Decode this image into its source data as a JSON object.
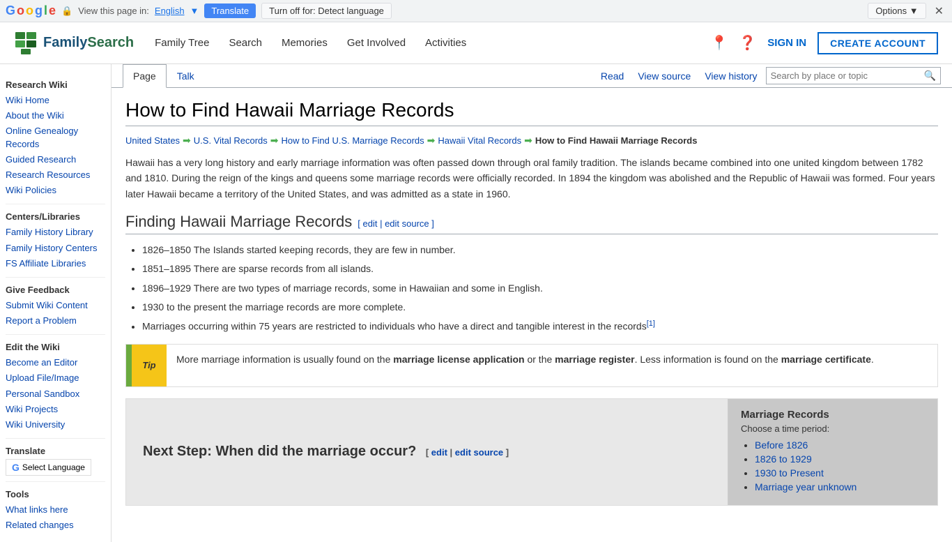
{
  "translateBar": {
    "googleLogo": "Google",
    "lockText": "🔒",
    "viewPageText": "View this page in:",
    "languageLink": "English",
    "languageDropdown": "▼",
    "translateBtn": "Translate",
    "turnOffBtn": "Turn off for: Detect language",
    "optionsBtn": "Options ▼",
    "closeBtn": "✕"
  },
  "nav": {
    "logoText": "FamilySearch",
    "links": [
      "Family Tree",
      "Search",
      "Memories",
      "Get Involved",
      "Activities"
    ],
    "signIn": "SIGN IN",
    "createAccount": "CREATE ACCOUNT"
  },
  "sidebar": {
    "researchWiki": "Research Wiki",
    "links1": [
      {
        "label": "Wiki Home",
        "href": "#"
      },
      {
        "label": "About the Wiki",
        "href": "#"
      },
      {
        "label": "Online Genealogy Records",
        "href": "#"
      },
      {
        "label": "Guided Research",
        "href": "#"
      },
      {
        "label": "Research Resources",
        "href": "#"
      },
      {
        "label": "Wiki Policies",
        "href": "#"
      }
    ],
    "centersLibraries": "Centers/Libraries",
    "links2": [
      {
        "label": "Family History Library",
        "href": "#"
      },
      {
        "label": "Family History Centers",
        "href": "#"
      },
      {
        "label": "FS Affiliate Libraries",
        "href": "#"
      }
    ],
    "giveFeedback": "Give Feedback",
    "links3": [
      {
        "label": "Submit Wiki Content",
        "href": "#"
      },
      {
        "label": "Report a Problem",
        "href": "#"
      }
    ],
    "editWiki": "Edit the Wiki",
    "links4": [
      {
        "label": "Become an Editor",
        "href": "#"
      },
      {
        "label": "Upload File/Image",
        "href": "#"
      },
      {
        "label": "Personal Sandbox",
        "href": "#"
      },
      {
        "label": "Wiki Projects",
        "href": "#"
      },
      {
        "label": "Wiki University",
        "href": "#"
      }
    ],
    "translate": "Translate",
    "selectLanguage": "Select Language",
    "tools": "Tools",
    "links5": [
      {
        "label": "What links here",
        "href": "#"
      },
      {
        "label": "Related changes",
        "href": "#"
      }
    ]
  },
  "tabs": {
    "page": "Page",
    "talk": "Talk",
    "read": "Read",
    "viewSource": "View source",
    "viewHistory": "View history",
    "searchPlaceholder": "Search by place or topic"
  },
  "article": {
    "title": "How to Find Hawaii Marriage Records",
    "breadcrumbs": [
      {
        "label": "United States",
        "href": "#"
      },
      {
        "label": "U.S. Vital Records",
        "href": "#"
      },
      {
        "label": "How to Find U.S. Marriage Records",
        "href": "#"
      },
      {
        "label": "Hawaii Vital Records",
        "href": "#"
      },
      {
        "label": "How to Find Hawaii Marriage Records",
        "current": true
      }
    ],
    "intro": "Hawaii has a very long history and early marriage information was often passed down through oral family tradition. The islands became combined into one united kingdom between 1782 and 1810. During the reign of the kings and queens some marriage records were officially recorded. In 1894 the kingdom was abolished and the Republic of Hawaii was formed. Four years later Hawaii became a territory of the United States, and was admitted as a state in 1960.",
    "findingTitle": "Finding Hawaii Marriage Records",
    "editLink": "edit",
    "editSourceLink": "edit source",
    "listItems": [
      "1826–1850 The Islands started keeping records, they are few in number.",
      "1851–1895 There are sparse records from all islands.",
      "1896–1929 There are two types of marriage records, some in Hawaiian and some in English.",
      "1930 to the present the marriage records are more complete.",
      "Marriages occurring within 75 years are restricted to individuals who have a direct and tangible interest in the records[1]"
    ],
    "tipText": "More marriage information is usually found on the ",
    "tipBold1": "marriage license application",
    "tipMiddle": " or the ",
    "tipBold2": "marriage register",
    "tipEnd": ". Less information is found on the ",
    "tipBold3": "marriage certificate",
    "tipDot": ".",
    "nextStep": "Next Step: When did the marriage occur?",
    "nextStepEdit": "edit",
    "nextStepEditSource": "edit source",
    "marriageRecordsTitle": "Marriage Records",
    "choosePeriod": "Choose a time period:",
    "periodLinks": [
      {
        "label": "Before 1826",
        "href": "#"
      },
      {
        "label": "1826 to 1929",
        "href": "#"
      },
      {
        "label": "1930 to Present",
        "href": "#"
      },
      {
        "label": "Marriage year unknown",
        "href": "#"
      }
    ]
  }
}
